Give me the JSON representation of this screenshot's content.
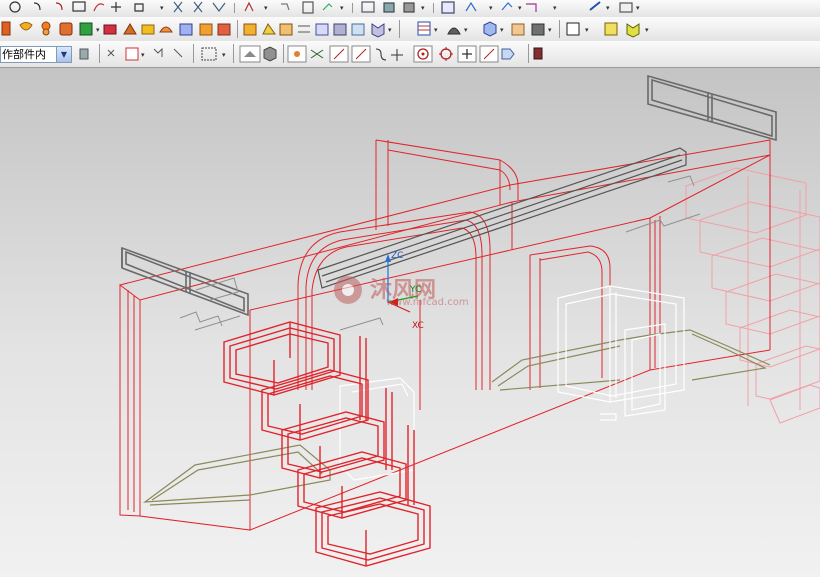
{
  "toolbar": {
    "part_filter": "作部件内",
    "row1_icons": [
      "circle-icon",
      "arc-icon",
      "fillet-icon",
      "rectangle-icon",
      "spline-icon",
      "point-icon",
      "pattern-icon",
      "trim-icon",
      "extend-icon",
      "mirror-icon",
      "offset-icon",
      "constraint-icon",
      "dimension-icon",
      "expression-icon",
      "sketch-icon",
      "layer-icon",
      "view-icon",
      "render-icon",
      "camera-icon",
      "measure-icon",
      "analysis-icon"
    ],
    "row2_icons": [
      "extrude-icon",
      "revolve-icon",
      "hole-icon",
      "boss-icon",
      "pocket-icon",
      "pad-icon",
      "slot-icon",
      "groove-icon",
      "blend-icon",
      "chamfer-icon",
      "shell-icon",
      "draft-icon",
      "unite-icon",
      "subtract-icon",
      "intersect-icon",
      "wire-icon",
      "grid-icon",
      "wcs-icon",
      "layer-settings-icon",
      "shaded-icon",
      "color-icon",
      "wireframe-icon",
      "orient-icon"
    ],
    "row3_icons": [
      "component-icon",
      "move-icon",
      "assembly-icon",
      "constrain-icon",
      "hide-icon",
      "select-box-icon",
      "face-select-icon",
      "body-select-icon",
      "snap-endpoint-icon",
      "snap-midpoint-icon",
      "snap-control-icon",
      "snap-intersection-icon",
      "snap-center-icon",
      "snap-quadrant-icon",
      "snap-existing-icon",
      "snap-on-curve-icon",
      "snap-on-face-icon",
      "stop-icon"
    ]
  },
  "viewport": {
    "axes": {
      "z": "ZC",
      "y": "YC",
      "x": "XC"
    },
    "watermark_main": "沐风网",
    "watermark_url": "www.mfcad.com"
  },
  "colors": {
    "wire_red": "#e0242c",
    "wire_light_red": "#f4a0a4",
    "wire_gray": "#707070",
    "wire_olive": "#8a8a5a",
    "wire_white": "#ffffff"
  }
}
